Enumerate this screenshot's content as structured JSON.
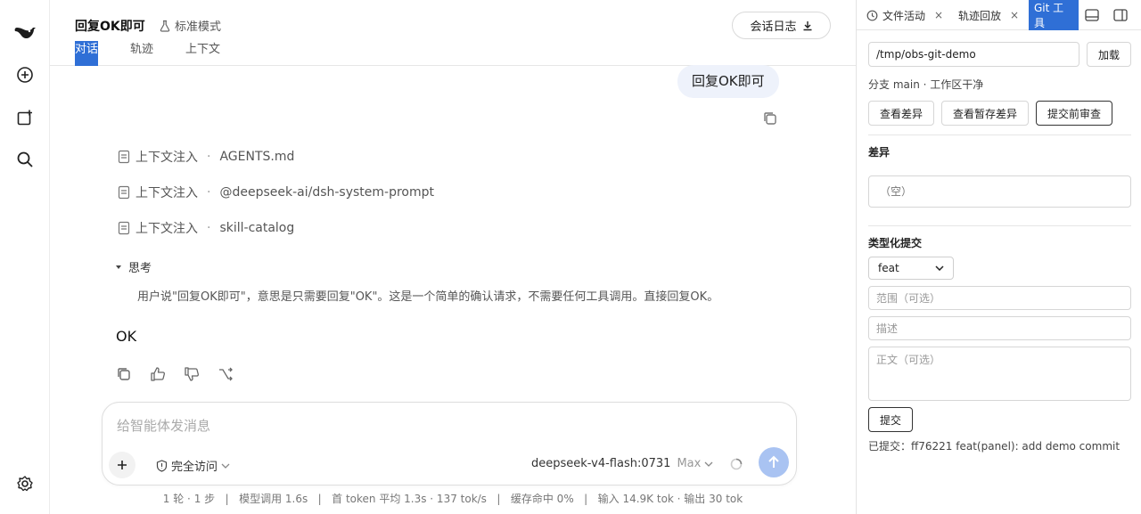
{
  "rail": {
    "icons": [
      "whale-logo-icon",
      "new-chat-icon",
      "new-window-icon",
      "search-icon",
      "settings-icon"
    ]
  },
  "header": {
    "title": "回复OK即可",
    "mode": "标准模式",
    "log_button": "会话日志",
    "tabs": [
      "对话",
      "轨迹",
      "上下文"
    ],
    "active_tab": "对话"
  },
  "conversation": {
    "user_message": "回复OK即可",
    "context_items": [
      {
        "label": "上下文注入",
        "sep": "·",
        "name": "AGENTS.md"
      },
      {
        "label": "上下文注入",
        "sep": "·",
        "name": "@deepseek-ai/dsh-system-prompt"
      },
      {
        "label": "上下文注入",
        "sep": "·",
        "name": "skill-catalog"
      }
    ],
    "thinking_label": "思考",
    "thinking_text": "用户说\"回复OK即可\"，意思是只需要回复\"OK\"。这是一个简单的确认请求，不需要任何工具调用。直接回复OK。",
    "answer": "OK"
  },
  "composer": {
    "placeholder": "给智能体发消息",
    "access": "完全访问",
    "model": "deepseek-v4-flash:0731",
    "effort": "Max"
  },
  "stats": "1 轮 · 1 步   |   模型调用 1.6s   |   首 token 平均 1.3s · 137 tok/s   |   缓存命中 0%   |   输入 14.9K tok · 输出 30 tok",
  "panel": {
    "tabs": [
      "文件活动",
      "轨迹回放",
      "Git 工具"
    ],
    "close_glyph": "×",
    "repo_path": "/tmp/obs-git-demo",
    "load_button": "加载",
    "branch_status": "分支 main · 工作区干净",
    "buttons": [
      "查看差异",
      "查看暂存差异",
      "提交前审查"
    ],
    "diff_title": "差异",
    "diff_empty": "（空）",
    "commit_section_title": "类型化提交",
    "commit_type": "feat",
    "scope_placeholder": "范围（可选）",
    "desc_placeholder": "描述",
    "body_placeholder": "正文（可选）",
    "commit_button": "提交",
    "committed_text": "已提交：ff76221 feat(panel): add demo commit"
  },
  "colors": {
    "accent": "#2f6fd6",
    "user_bubble": "#eef2fb",
    "send_button": "#a9c3f2"
  }
}
